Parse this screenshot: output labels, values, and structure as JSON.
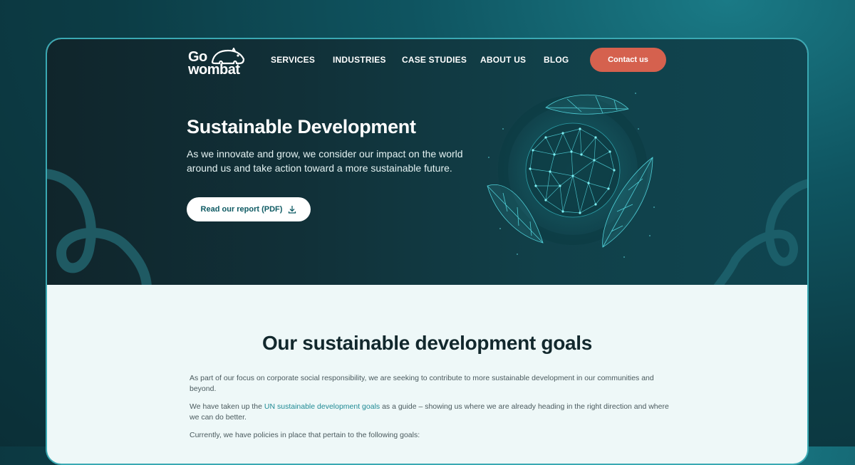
{
  "brand": {
    "line1": "Go",
    "line2": "wombat"
  },
  "nav": {
    "items": [
      {
        "label": "SERVICES"
      },
      {
        "label": "INDUSTRIES"
      },
      {
        "label": "CASE STUDIES"
      },
      {
        "label": "ABOUT US"
      },
      {
        "label": "BLOG"
      }
    ],
    "cta": "Contact us"
  },
  "hero": {
    "title": "Sustainable Development",
    "subtitle": "As we innovate and grow, we consider our impact on the world around us and take action toward a more sustainable future.",
    "button": "Read our report (PDF)",
    "button_icon": "download-icon"
  },
  "goals": {
    "title": "Our sustainable development goals",
    "para1": "As part of our focus on corporate social responsibility, we are seeking to contribute to more sustainable development in our communities and beyond.",
    "para2_before": "We have taken up the ",
    "para2_link": "UN sustainable development goals",
    "para2_after": " as a guide – showing us where we are already heading in the right direction and where we can do better.",
    "para3": "Currently, we have policies in place that pertain to the following goals:"
  },
  "colors": {
    "accent": "#d5614e",
    "link": "#1f8a94",
    "hero_bg": "#113139",
    "content_bg": "#eef8f8",
    "frame_border": "#3aa9b3"
  }
}
